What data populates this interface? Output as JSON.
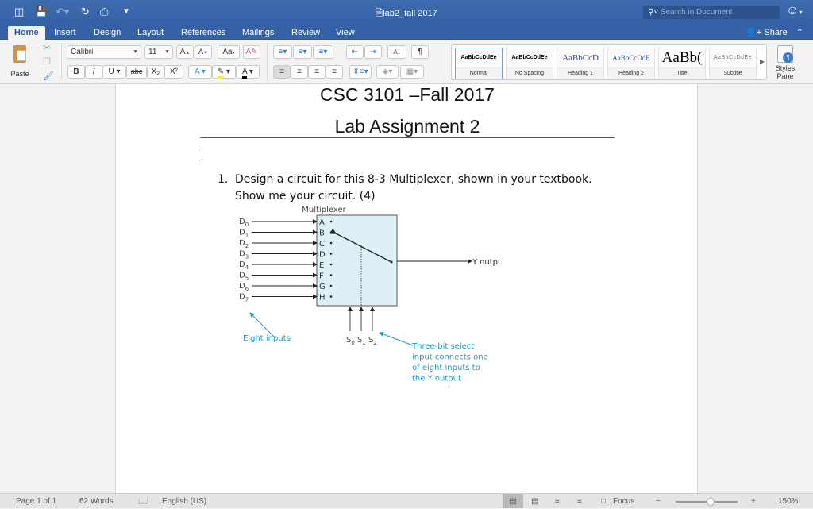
{
  "window": {
    "title": "lab2_fall 2017",
    "search_placeholder": "Search in Document"
  },
  "quick_access": [
    "sidebar-toggle-icon",
    "save-icon",
    "undo-icon",
    "redo-icon",
    "print-icon",
    "customize-icon"
  ],
  "tabs": [
    {
      "label": "Home",
      "active": true
    },
    {
      "label": "Insert"
    },
    {
      "label": "Design"
    },
    {
      "label": "Layout"
    },
    {
      "label": "References"
    },
    {
      "label": "Mailings"
    },
    {
      "label": "Review"
    },
    {
      "label": "View"
    }
  ],
  "share_label": "Share",
  "ribbon": {
    "paste_label": "Paste",
    "font_name": "Calibri",
    "font_size": "11",
    "bold": "B",
    "italic": "I",
    "underline": "U",
    "strikethrough": "abc",
    "subscript": "X₂",
    "superscript": "X²",
    "styles": [
      {
        "preview": "AaBbCcDdEe",
        "label": "Normal",
        "selected": true
      },
      {
        "preview": "AaBbCcDdEe",
        "label": "No Spacing"
      },
      {
        "preview": "AaBbCcD",
        "label": "Heading 1"
      },
      {
        "preview": "AaBbCcDdE",
        "label": "Heading 2"
      },
      {
        "preview": "AaBb(",
        "label": "Title"
      },
      {
        "preview": "AaBbCcDdEe",
        "label": "Subtitle"
      }
    ],
    "styles_pane_label_1": "Styles",
    "styles_pane_label_2": "Pane"
  },
  "document": {
    "heading_1": "CSC 3101 –Fall 2017",
    "heading_2": "Lab Assignment 2",
    "item_number": "1.",
    "item_line_1": "Design a circuit for this 8-3 Multiplexer, shown in your textbook.",
    "item_line_2": "Show me your circuit. (4)",
    "figure": {
      "title": "Multiplexer",
      "inputs": [
        "D",
        "D",
        "D",
        "D",
        "D",
        "D",
        "D",
        "D"
      ],
      "input_subscripts": [
        "0",
        "1",
        "2",
        "3",
        "4",
        "5",
        "6",
        "7"
      ],
      "ports": [
        "A",
        "B",
        "C",
        "D",
        "E",
        "F",
        "G",
        "H"
      ],
      "output_label": "Y output",
      "selects": [
        "S",
        "S",
        "S"
      ],
      "select_subscripts": [
        "0",
        "1",
        "2"
      ],
      "note_inputs": "Eight inputs",
      "note_select": [
        "Three-bit select",
        "input connects one",
        "of eight inputs to",
        "the Y output"
      ],
      "accent_color": "#1e9bc4",
      "box_fill": "#ddf0f5"
    }
  },
  "status": {
    "page": "Page 1 of 1",
    "words": "62 Words",
    "language": "English (US)",
    "focus_label": "Focus",
    "zoom": "150%",
    "zoom_fraction": 0.57
  }
}
